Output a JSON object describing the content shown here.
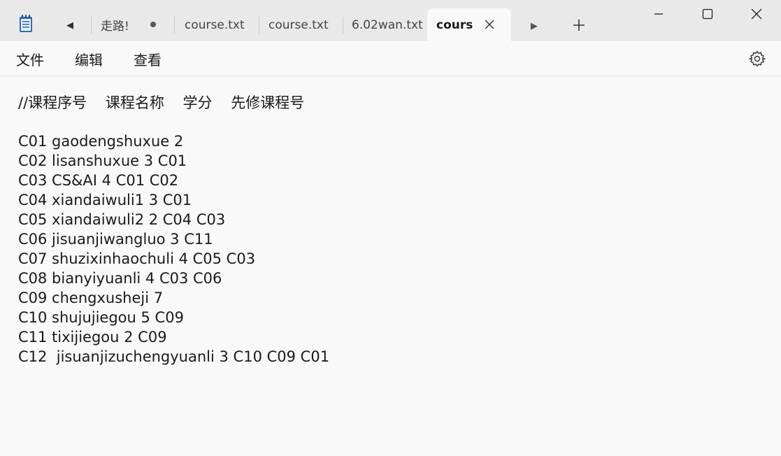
{
  "tabs": [
    {
      "label": "走路!",
      "unsaved": true
    },
    {
      "label": "course.txt",
      "unsaved": false
    },
    {
      "label": "course.txt",
      "unsaved": false
    },
    {
      "label": "6.02wan.txt",
      "unsaved": false
    },
    {
      "label": "cours",
      "unsaved": false,
      "active": true
    }
  ],
  "menu": {
    "file": "文件",
    "edit": "编辑",
    "view": "查看"
  },
  "editor": {
    "header": "//课程序号    课程名称    学分    先修课程号",
    "lines": [
      "C01 gaodengshuxue 2",
      "C02 lisanshuxue 3 C01",
      "C03 CS&AI 4 C01 C02",
      "C04 xiandaiwuli1 3 C01",
      "C05 xiandaiwuli2 2 C04 C03",
      "C06 jisuanjiwangluo 3 C11",
      "C07 shuzixinhaochuli 4 C05 C03",
      "C08 bianyiyuanli 4 C03 C06",
      "C09 chengxusheji 7",
      "C10 shujujiegou 5 C09",
      "C11 tixijiegou 2 C09",
      "C12  jisuanjizuchengyuanli 3 C10 C09 C01"
    ]
  },
  "colors": {
    "titlebar_bg": "#e9e9e9",
    "editor_bg": "#f9f9f9",
    "text": "#1a1a1a",
    "app_icon_blue": "#2f6fb5"
  },
  "icons": {
    "app": "notepad-icon",
    "scroll_left": "chevron-left-icon",
    "scroll_right": "chevron-right-icon",
    "close_tab": "close-icon",
    "new_tab": "plus-icon",
    "minimize": "minimize-icon",
    "maximize": "maximize-icon",
    "close_window": "close-icon",
    "settings": "gear-icon"
  }
}
